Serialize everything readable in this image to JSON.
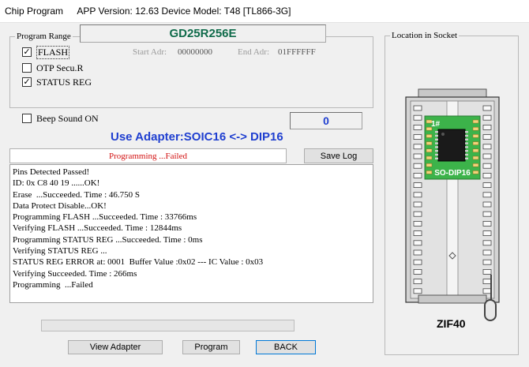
{
  "window": {
    "title": "Chip Program",
    "app_info": "APP Version: 12.63 Device Model: T48 [TL866-3G]"
  },
  "program_range": {
    "legend": "Program Range",
    "chip_name": "GD25R256E",
    "options": [
      {
        "label": "FLASH",
        "checked": true
      },
      {
        "label": "OTP Secu.R",
        "checked": false
      },
      {
        "label": "STATUS REG",
        "checked": true
      }
    ],
    "start_adr_label": "Start Adr:",
    "start_adr_value": "00000000",
    "end_adr_label": "End Adr:",
    "end_adr_value": "01FFFFFF"
  },
  "beep": {
    "label": "Beep Sound ON",
    "checked": false
  },
  "counter": "0",
  "adapter_title": "Use Adapter:SOIC16 <-> DIP16",
  "status_text": "Programming  ...Failed",
  "save_log_label": "Save Log",
  "log_lines": [
    "Pins Detected Passed!",
    "ID: 0x C8 40 19 ......OK!",
    "Erase  ...Succeeded. Time : 46.750 S",
    "Data Protect Disable...OK!",
    "Programming FLASH ...Succeeded. Time : 33766ms",
    "Verifying FLASH ...Succeeded. Time : 12844ms",
    "Programming STATUS REG ...Succeeded. Time : 0ms",
    "Verifying STATUS REG ...",
    "STATUS REG ERROR at: 0001  Buffer Value :0x02 --- IC Value : 0x03",
    "Verifying Succeeded. Time : 266ms",
    "Programming  ...Failed"
  ],
  "progress": 0,
  "buttons": {
    "view_adapter": "View Adapter",
    "program": "Program",
    "back": "BACK"
  },
  "socket": {
    "legend": "Location in Socket",
    "pin1_marker": "1#",
    "adapter_label": "SO-DIP16",
    "zif_label": "ZIF40"
  },
  "colors": {
    "chip_name": "#0f6b4a",
    "accent_blue": "#1f3fd0",
    "status_red": "#d21010",
    "adapter_green": "#38b34a"
  }
}
